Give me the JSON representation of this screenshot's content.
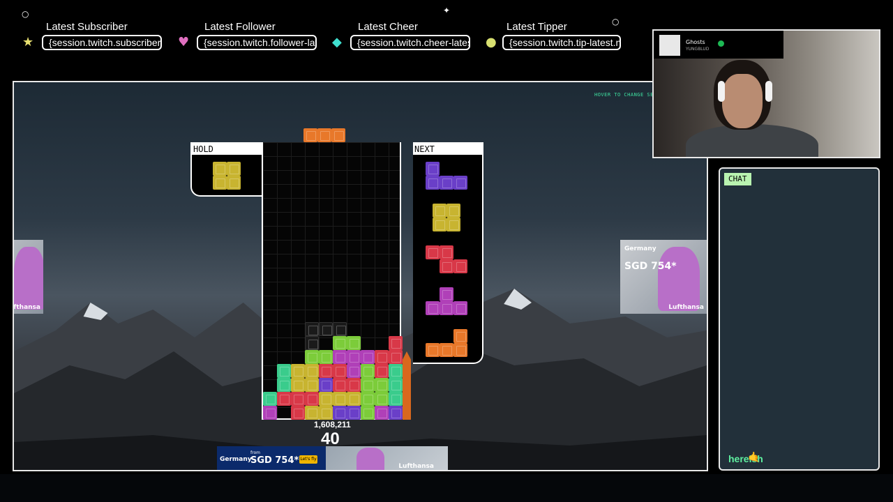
{
  "alerts": {
    "subscriber": {
      "title": "Latest Subscriber",
      "value": "{session.twitch.subscriber-latest}"
    },
    "follower": {
      "title": "Latest Follower",
      "value": "{session.twitch.follower-latest}"
    },
    "cheer": {
      "title": "Latest Cheer",
      "value": "{session.twitch.cheer-latest}"
    },
    "tipper": {
      "title": "Latest Tipper",
      "value": "{session.twitch.tip-latest.name}"
    }
  },
  "game": {
    "hover_hint": "HOVER TO CHANGE SETTI",
    "hold_label": "HOLD",
    "next_label": "NEXT",
    "score": "1,608,211",
    "lines": "40"
  },
  "ads": {
    "destination": "Germany",
    "from_label": "from",
    "price": "SGD 754*",
    "cta": "Let's fly",
    "brand": "Lufthansa"
  },
  "now_playing": {
    "title": "Ghosts",
    "artist": "YUNGBLUD"
  },
  "chat": {
    "tab_label": "CHAT",
    "messages": [
      {
        "user": "hereish"
      }
    ]
  },
  "colors": {
    "orange": "#e8782a",
    "yellow": "#c8b430",
    "purple": "#6a3fc8",
    "red": "#d83848",
    "magenta": "#b040b8",
    "green": "#7ccc3a",
    "teal": "#3acc8c",
    "chat_accent": "#5ef0a0"
  }
}
